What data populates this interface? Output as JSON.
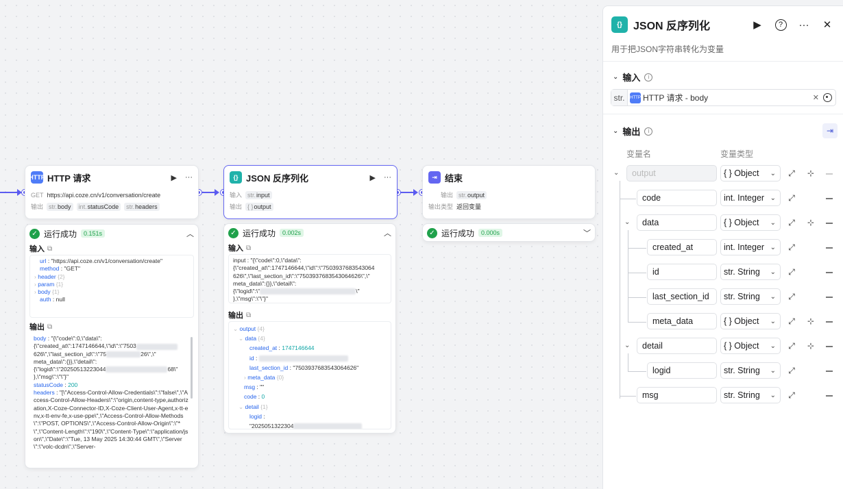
{
  "colors": {
    "accent": "#5b5bf0",
    "success": "#1fa14b",
    "json_icon": "#20b2aa",
    "http_icon": "#4f7cf7"
  },
  "http_node": {
    "title": "HTTP 请求",
    "method": "GET",
    "url": "https://api.coze.cn/v1/conversation/create",
    "output_label": "输出",
    "outputs": [
      {
        "type": "str.",
        "name": "body"
      },
      {
        "type": "int.",
        "name": "statusCode"
      },
      {
        "type": "str.",
        "name": "headers"
      }
    ],
    "result": {
      "status": "运行成功",
      "time": "0.151s",
      "input_label": "输入",
      "input_lines": [
        {
          "key": "url",
          "value": "\"https://api.coze.cn/v1/conversation/create\""
        },
        {
          "key": "method",
          "value": "\"GET\""
        },
        {
          "key": "header",
          "value": "{2}"
        },
        {
          "key": "param",
          "value": "{1}"
        },
        {
          "key": "body",
          "value": "{1}"
        },
        {
          "key": "auth",
          "value": "null"
        }
      ],
      "output_label": "输出",
      "output_body_key": "body",
      "output_body_1": "\"{\\\"code\\\":0,\\\"data\\\":",
      "output_body_2": "{\\\"created_at\\\":1747146644,\\\"id\\\":\\\"7503",
      "output_body_3": "626\\\",\\\"last_section_id\\\":\\\"75",
      "output_body_3b": "26\\\",\\\"",
      "output_body_4": "meta_data\\\":{}},\\\"detail\\\":",
      "output_body_5": "{\\\"logid\\\":\\\"20250513223044",
      "output_body_5b": "68\\\"",
      "output_body_6": "},\\\"msg\\\":\\\"\\\"}\"",
      "status_key": "statusCode",
      "status_value": "200",
      "headers_key": "headers",
      "headers_text": "\"[\\\"Access-Control-Allow-Credentials\\\":\\\"false\\\",\\\"Access-Control-Allow-Headers\\\":\\\"origin,content-type,authorization,X-Coze-Connector-ID,X-Coze-Client-User-Agent,x-tt-env,x-tt-env-fe,x-use-ppe\\\",\\\"Access-Control-Allow-Methods\\\":\\\"POST, OPTIONS\\\",\\\"Access-Control-Allow-Origin\\\":\\\"*\\\",\\\"Content-Length\\\":\\\"190\\\",\\\"Content-Type\\\":\\\"application/json\\\",\\\"Date\\\":\\\"Tue, 13 May 2025 14:30:44 GMT\\\",\\\"Server\\\":\\\"volc-dcdn\\\",\\\"Server-"
    }
  },
  "json_node": {
    "title": "JSON 反序列化",
    "input_label": "输入",
    "input_type": "str.",
    "input_name": "input",
    "output_label": "输出",
    "output_type": "{ }",
    "output_name": "output",
    "result": {
      "status": "运行成功",
      "time": "0.002s",
      "input_label": "输入",
      "input_text_1": "input : \"{\\\"code\\\":0,\\\"data\\\":",
      "input_text_2": "{\\\"created_at\\\":1747146644,\\\"id\\\":\\\"7503937683543064",
      "input_text_3": "626\\\",\\\"last_section_id\\\":\\\"7503937683543064626\\\",\\\"",
      "input_text_4": "meta_data\\\":{}},\\\"detail\\\":",
      "input_text_5": "{\\\"logid\\\":\\\"",
      "input_text_5b": "\\\"",
      "input_text_6": "},\\\"msg\\\":\\\"\\\"}\"",
      "output_label": "输出",
      "tree": [
        {
          "level": 0,
          "key": "output",
          "value": "{4}",
          "arrow": "v"
        },
        {
          "level": 1,
          "key": "data",
          "value": "{4}",
          "arrow": "v"
        },
        {
          "level": 2,
          "key": "created_at",
          "value": "1747146644",
          "kind": "num"
        },
        {
          "level": 2,
          "key": "id",
          "value": "",
          "kind": "blur"
        },
        {
          "level": 2,
          "key": "last_section_id",
          "value": "\"7503937683543064626\""
        },
        {
          "level": 2,
          "key": "meta_data",
          "value": "{0}",
          "arrow": ">"
        },
        {
          "level": 1,
          "key": "msg",
          "value": "\"\""
        },
        {
          "level": 1,
          "key": "code",
          "value": "0",
          "kind": "num"
        },
        {
          "level": 1,
          "key": "detail",
          "value": "{1}",
          "arrow": "v"
        },
        {
          "level": 2,
          "key": "logid",
          "value": ""
        },
        {
          "level": 2,
          "key": "",
          "value": "\"2025051322304"
        }
      ]
    }
  },
  "end_node": {
    "title": "结束",
    "output_label": "输出",
    "output_type": "str.",
    "output_name": "output",
    "output_type_label": "输出类型",
    "output_type_value": "返回变量",
    "result": {
      "status": "运行成功",
      "time": "0.000s"
    }
  },
  "panel": {
    "title": "JSON 反序列化",
    "description": "用于把JSON字符串转化为变量",
    "input_section": "输入",
    "input_type": "str.",
    "input_ref": "HTTP 请求 - body",
    "output_section": "输出",
    "col_name": "变量名",
    "col_type": "变量类型",
    "rows": [
      {
        "name": "output",
        "type": "{ } Object",
        "disabled": true
      },
      {
        "name": "code",
        "type": "int. Integer"
      },
      {
        "name": "data",
        "type": "{ } Object"
      },
      {
        "name": "created_at",
        "type": "int. Integer"
      },
      {
        "name": "id",
        "type": "str. String"
      },
      {
        "name": "last_section_id",
        "type": "str. String"
      },
      {
        "name": "meta_data",
        "type": "{ } Object"
      },
      {
        "name": "detail",
        "type": "{ } Object"
      },
      {
        "name": "logid",
        "type": "str. String"
      },
      {
        "name": "msg",
        "type": "str. String"
      }
    ]
  }
}
